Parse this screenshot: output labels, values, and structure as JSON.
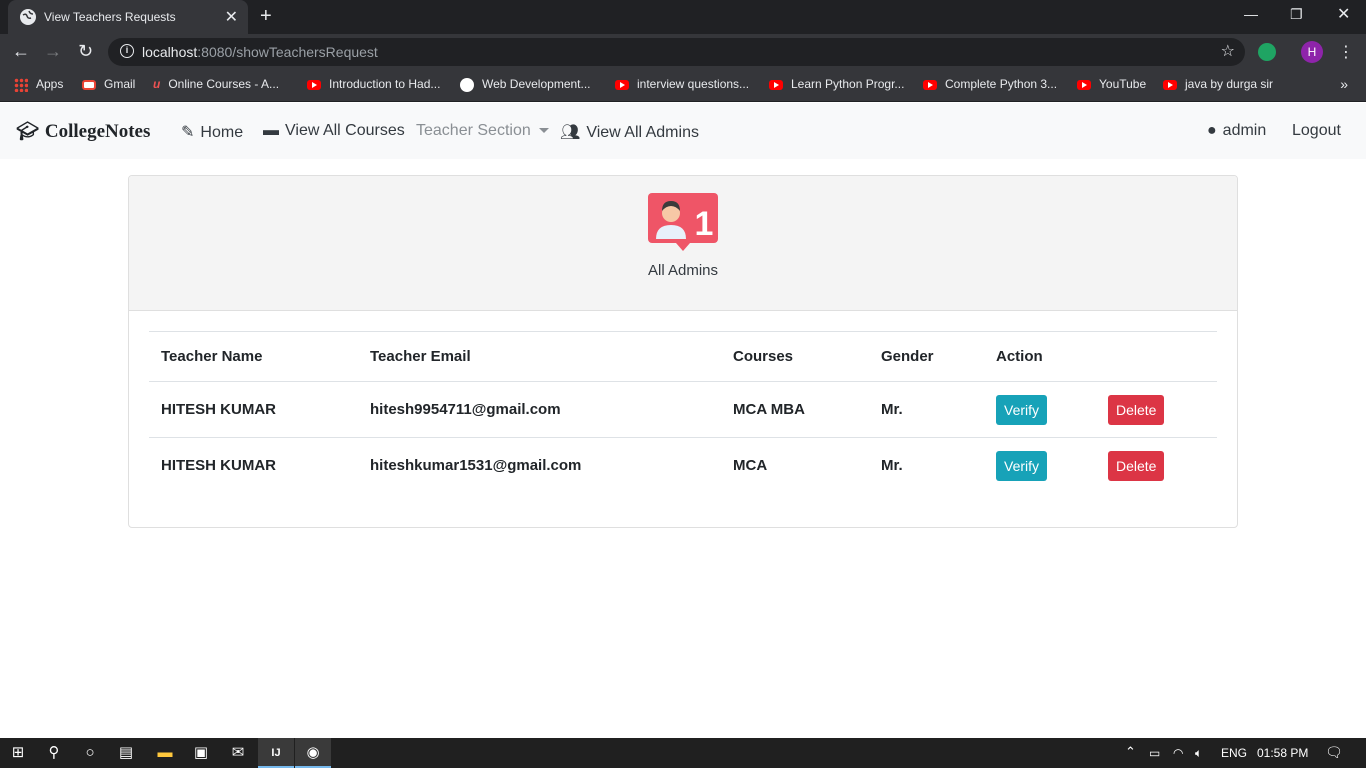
{
  "browser": {
    "tab_title": "View Teachers Requests",
    "url_host": "localhost",
    "url_path": ":8080/showTeachersRequest",
    "profile_initial": "H"
  },
  "bookmarks": [
    {
      "label": "Apps",
      "icon": "apps-grid-icon"
    },
    {
      "label": "Gmail",
      "icon": "gmail-icon"
    },
    {
      "label": "Online Courses - A...",
      "icon": "udemy-icon"
    },
    {
      "label": "Introduction to Had...",
      "icon": "youtube-icon"
    },
    {
      "label": "Web Development...",
      "icon": "web-icon"
    },
    {
      "label": "interview questions...",
      "icon": "youtube-icon"
    },
    {
      "label": "Learn Python Progr...",
      "icon": "youtube-icon"
    },
    {
      "label": "Complete Python 3...",
      "icon": "youtube-icon"
    },
    {
      "label": "YouTube",
      "icon": "youtube-icon"
    },
    {
      "label": "java by durga sir",
      "icon": "youtube-icon"
    }
  ],
  "navbar": {
    "brand": "CollegeNotes",
    "home": "Home",
    "courses": "View All Courses",
    "teacher_section": "Teacher Section",
    "admins": "View All Admins",
    "user": "admin",
    "logout": "Logout"
  },
  "card": {
    "title": "All Admins",
    "badge_count": "1"
  },
  "table": {
    "headers": [
      "Teacher Name",
      "Teacher Email",
      "Courses",
      "Gender",
      "Action"
    ],
    "rows": [
      {
        "name": "HITESH KUMAR",
        "email": "hitesh9954711@gmail.com",
        "courses": "MCA MBA",
        "gender": "Mr.",
        "verify": "Verify",
        "delete": "Delete"
      },
      {
        "name": "HITESH KUMAR",
        "email": "hiteshkumar1531@gmail.com",
        "courses": "MCA",
        "gender": "Mr.",
        "verify": "Verify",
        "delete": "Delete"
      }
    ]
  },
  "taskbar": {
    "language": "ENG",
    "time": "01:58 PM"
  },
  "colors": {
    "verify": "#17a2b8",
    "delete": "#dc3545",
    "navbar_bg": "#f8f9fa"
  }
}
